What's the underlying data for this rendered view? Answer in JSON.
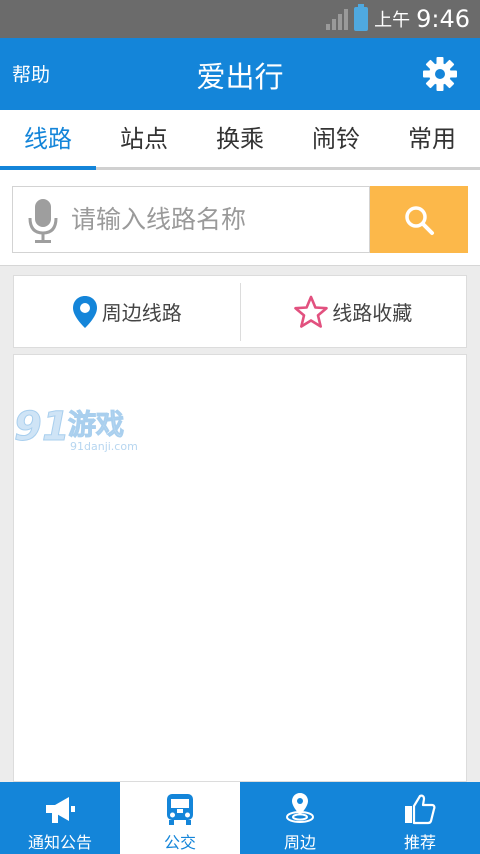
{
  "status_bar": {
    "ampm": "上午",
    "time": "9:46"
  },
  "header": {
    "help_label": "帮助",
    "title": "爱出行"
  },
  "tabs": [
    {
      "label": "线路",
      "active": true
    },
    {
      "label": "站点",
      "active": false
    },
    {
      "label": "换乘",
      "active": false
    },
    {
      "label": "闹铃",
      "active": false
    },
    {
      "label": "常用",
      "active": false
    }
  ],
  "search": {
    "placeholder": "请输入线路名称",
    "value": ""
  },
  "quick_actions": {
    "nearby_label": "周边线路",
    "favorites_label": "线路收藏"
  },
  "watermark": {
    "brand": "游戏",
    "url": "91danji.com"
  },
  "bottom_nav": [
    {
      "label": "通知公告",
      "icon": "megaphone-icon",
      "active": false
    },
    {
      "label": "公交",
      "icon": "bus-icon",
      "active": true
    },
    {
      "label": "周边",
      "icon": "location-pin-icon",
      "active": false
    },
    {
      "label": "推荐",
      "icon": "thumbs-up-icon",
      "active": false
    }
  ],
  "colors": {
    "primary": "#1485d9",
    "search_button": "#fcb84a",
    "pin": "#1485d9",
    "star": "#e2517f"
  }
}
